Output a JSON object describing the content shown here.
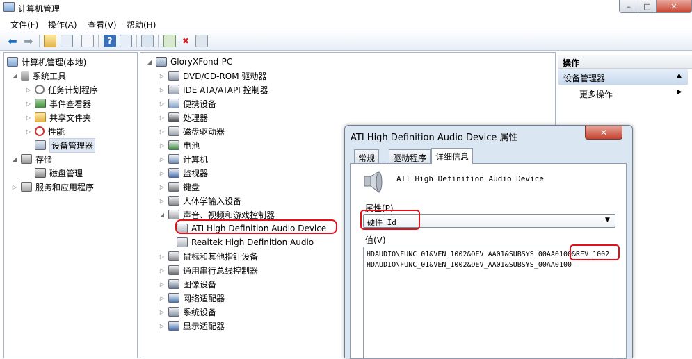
{
  "window": {
    "title": "计算机管理",
    "close": "✕",
    "maximize": "□",
    "minimize": "–"
  },
  "menu": [
    "文件(F)",
    "操作(A)",
    "查看(V)",
    "帮助(H)"
  ],
  "toolbar_icons": [
    "back-arrow-icon",
    "forward-arrow-icon",
    "up-folder-icon",
    "show-tree-icon",
    "properties-icon",
    "help-icon",
    "action-pane-icon",
    "scan-hardware-icon",
    "update-driver-icon",
    "uninstall-icon",
    "disable-device-icon"
  ],
  "left_tree": [
    {
      "label": "计算机管理(本地)",
      "level": 0,
      "expander": ""
    },
    {
      "label": "系统工具",
      "level": 1,
      "expander": "◢"
    },
    {
      "label": "任务计划程序",
      "level": 2,
      "expander": "▷"
    },
    {
      "label": "事件查看器",
      "level": 2,
      "expander": "▷"
    },
    {
      "label": "共享文件夹",
      "level": 2,
      "expander": "▷"
    },
    {
      "label": "性能",
      "level": 2,
      "expander": "▷"
    },
    {
      "label": "设备管理器",
      "level": 2,
      "expander": ""
    },
    {
      "label": "存储",
      "level": 1,
      "expander": "◢"
    },
    {
      "label": "磁盘管理",
      "level": 2,
      "expander": ""
    },
    {
      "label": "服务和应用程序",
      "level": 1,
      "expander": "▷"
    }
  ],
  "device_tree": {
    "root": "GloryXFond-PC",
    "categories": [
      {
        "label": "DVD/CD-ROM 驱动器",
        "expander": "▷"
      },
      {
        "label": "IDE ATA/ATAPI 控制器",
        "expander": "▷"
      },
      {
        "label": "便携设备",
        "expander": "▷"
      },
      {
        "label": "处理器",
        "expander": "▷"
      },
      {
        "label": "磁盘驱动器",
        "expander": "▷"
      },
      {
        "label": "电池",
        "expander": "▷"
      },
      {
        "label": "计算机",
        "expander": "▷"
      },
      {
        "label": "监视器",
        "expander": "▷"
      },
      {
        "label": "键盘",
        "expander": "▷"
      },
      {
        "label": "人体学输入设备",
        "expander": "▷"
      },
      {
        "label": "声音、视频和游戏控制器",
        "expander": "◢"
      },
      {
        "label": "ATI High Definition Audio Device",
        "expander": "",
        "child": true
      },
      {
        "label": "Realtek High Definition Audio",
        "expander": "",
        "child": true
      },
      {
        "label": "鼠标和其他指针设备",
        "expander": "▷"
      },
      {
        "label": "通用串行总线控制器",
        "expander": "▷"
      },
      {
        "label": "图像设备",
        "expander": "▷"
      },
      {
        "label": "网络适配器",
        "expander": "▷"
      },
      {
        "label": "系统设备",
        "expander": "▷"
      },
      {
        "label": "显示适配器",
        "expander": "▷"
      }
    ]
  },
  "actions": {
    "header": "操作",
    "section": "设备管理器",
    "more": "更多操作",
    "section_arrow": "▲",
    "more_arrow": "▶"
  },
  "dialog": {
    "title": "ATI High Definition Audio Device 属性",
    "close": "✕",
    "tabs": [
      "常规",
      "驱动程序",
      "详细信息"
    ],
    "device_name": "ATI High Definition Audio Device",
    "property_label": "属性(P)",
    "property_value": "硬件 Id",
    "property_arrow": "▼",
    "value_label": "值(V)",
    "values": [
      "HDAUDIO\\FUNC_01&VEN_1002&DEV_AA01&SUBSYS_00AA0100&REV_1002",
      "HDAUDIO\\FUNC_01&VEN_1002&DEV_AA01&SUBSYS_00AA0100"
    ]
  },
  "colors": {
    "highlight": "#e3101a",
    "selection": "#dde6f2",
    "dialog_frame": "#dbe6f3"
  }
}
